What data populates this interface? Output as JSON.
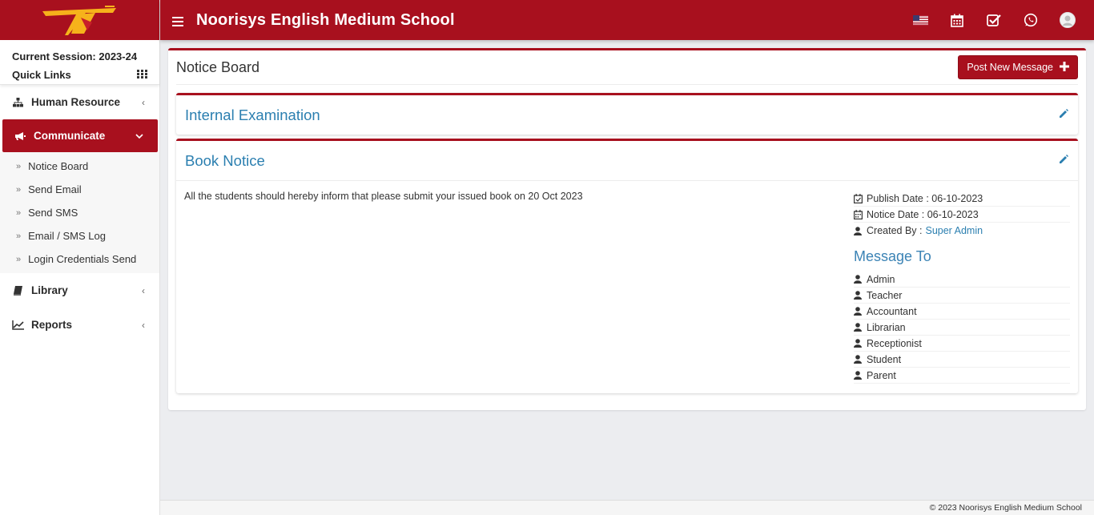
{
  "app": {
    "school_name": "Noorisys English Medium School"
  },
  "colors": {
    "brand": "#a8101e",
    "link": "#2b7fb0",
    "logo_accent": "#f6b21b"
  },
  "header": {
    "icons": [
      "us-flag-icon",
      "calendar-icon",
      "checkbox-icon",
      "whatsapp-icon",
      "user-avatar"
    ]
  },
  "sidebar": {
    "session_label": "Current Session: 2023-24",
    "quick_links_label": "Quick Links",
    "items": [
      {
        "label": "Human Resource",
        "icon": "sitemap-icon",
        "expanded": false
      },
      {
        "label": "Communicate",
        "icon": "bullhorn-icon",
        "expanded": true,
        "active": true
      },
      {
        "label": "Library",
        "icon": "book-icon",
        "expanded": false
      },
      {
        "label": "Reports",
        "icon": "line-chart-icon",
        "expanded": false
      }
    ],
    "submenu": [
      {
        "label": "Notice Board"
      },
      {
        "label": "Send Email"
      },
      {
        "label": "Send SMS"
      },
      {
        "label": "Email / SMS Log"
      },
      {
        "label": "Login Credentials Send"
      }
    ]
  },
  "main": {
    "page_title": "Notice Board",
    "post_button_label": "Post New Message",
    "notices": [
      {
        "title": "Internal Examination"
      },
      {
        "title": "Book Notice",
        "message": "All the students should hereby inform that please submit your issued book on 20 Oct 2023",
        "publish_date": "Publish Date : 06-10-2023",
        "notice_date": "Notice Date : 06-10-2023",
        "created_by_label": "Created By :",
        "created_by": "Super Admin",
        "message_to_heading": "Message To",
        "recipients": [
          "Admin",
          "Teacher",
          "Accountant",
          "Librarian",
          "Receptionist",
          "Student",
          "Parent"
        ]
      }
    ]
  },
  "footer": {
    "text": "© 2023 Noorisys English Medium School"
  }
}
